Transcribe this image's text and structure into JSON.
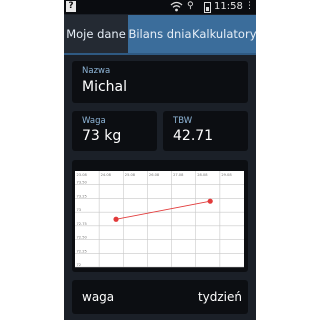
{
  "status_bar": {
    "time": "11:58",
    "icons": [
      "help-icon",
      "wifi-icon",
      "usb-icon",
      "battery-icon",
      "overflow-menu-icon"
    ]
  },
  "tabs": [
    {
      "label": "Moje dane",
      "active": true
    },
    {
      "label": "Bilans dnia",
      "active": false
    },
    {
      "label": "Kalkulatory",
      "active": false
    }
  ],
  "profile": {
    "name_label": "Nazwa",
    "name_value": "Michal"
  },
  "stats": {
    "waga_label": "Waga",
    "waga_value": "73 kg",
    "tbw_label": "TBW",
    "tbw_value": "42.71"
  },
  "chart_data": {
    "type": "line",
    "x_ticks": [
      "23.08",
      "24.08",
      "25.08",
      "26.08",
      "27.08",
      "28.08",
      "29.08"
    ],
    "y_ticks": [
      "73.50",
      "73.25",
      "73",
      "72.75",
      "72.50",
      "72.25",
      "72"
    ],
    "xlim": [
      0,
      7
    ],
    "ylim": [
      72,
      73.75
    ],
    "series": [
      {
        "x": [
          1.7,
          5.6
        ],
        "y": [
          72.87,
          73.2
        ],
        "color": "#e23a3a"
      }
    ],
    "grid": true,
    "colors": {
      "background": "#ffffff",
      "grid": "#c8c8c8",
      "line": "#e23a3a"
    }
  },
  "bottom": {
    "metric_label": "waga",
    "period_label": "tydzień"
  },
  "colors": {
    "tab_active": "#242a33",
    "tab_inactive": "#3b6d9b",
    "card_bg": "#0c0e12",
    "label": "#8fb6d8"
  }
}
